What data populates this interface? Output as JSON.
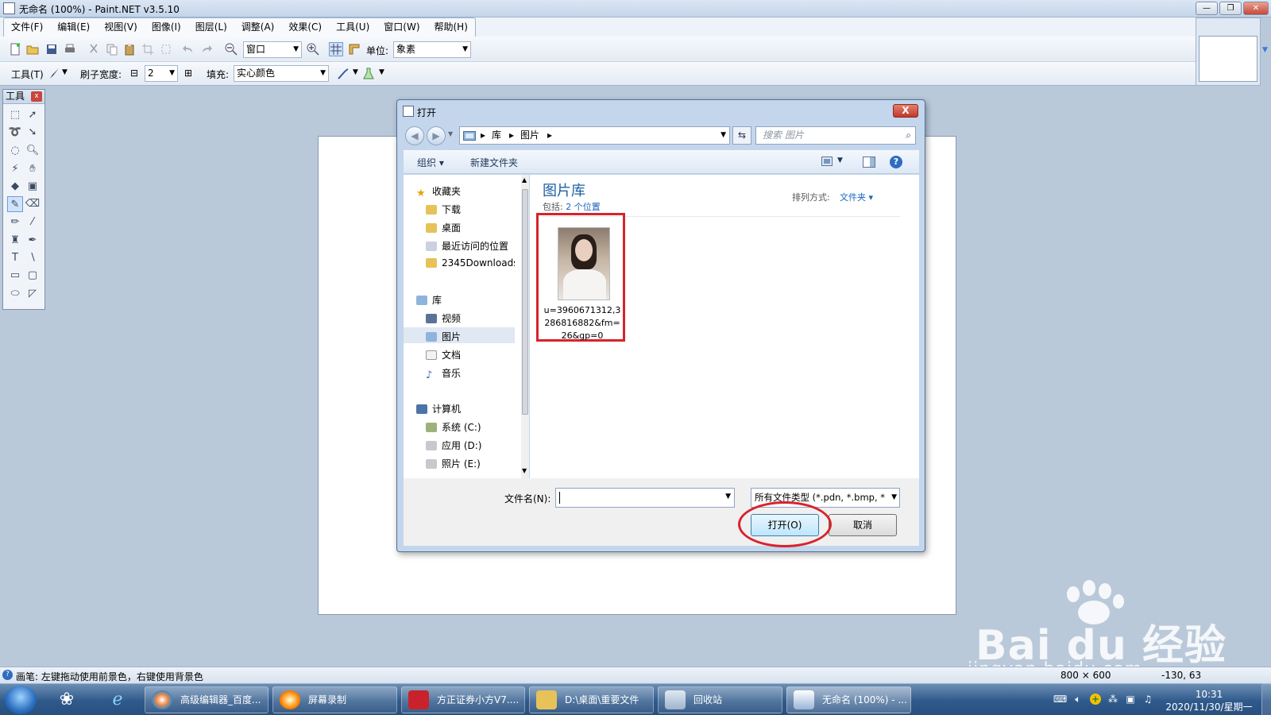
{
  "app": {
    "title": "无命名 (100%) - Paint.NET v3.5.10"
  },
  "menu": [
    "文件(F)",
    "编辑(E)",
    "视图(V)",
    "图像(I)",
    "图层(L)",
    "调整(A)",
    "效果(C)",
    "工具(U)",
    "窗口(W)",
    "帮助(H)"
  ],
  "toolbar1": {
    "zoom_value": "窗口",
    "unit_label": "单位:",
    "unit_value": "象素"
  },
  "toolbar2": {
    "tool_label": "工具(T)",
    "brush_width_label": "刷子宽度:",
    "brush_width_value": "2",
    "fill_label": "填充:",
    "fill_value": "实心颜色"
  },
  "tools_panel": {
    "title": "工具",
    "close": "x"
  },
  "dialog": {
    "title": "打开",
    "close": "X",
    "address": {
      "items": [
        "库",
        "图片"
      ]
    },
    "search_placeholder": "搜索 图片",
    "commands": {
      "organize": "组织 ▾",
      "new_folder": "新建文件夹"
    },
    "nav": {
      "favorites": "收藏夹",
      "favorites_items": [
        "下载",
        "桌面",
        "最近访问的位置",
        "2345Downloads"
      ],
      "libraries": "库",
      "libraries_items": [
        "视频",
        "图片",
        "文档",
        "音乐"
      ],
      "computer": "计算机",
      "computer_items": [
        "系统 (C:)",
        "应用 (D:)",
        "照片 (E:)"
      ]
    },
    "library": {
      "title": "图片库",
      "includes_label": "包括:",
      "includes_link": "2 个位置",
      "sort_label": "排列方式:",
      "sort_value": "文件夹 ▾"
    },
    "file": {
      "name": "u=3960671312,3286816882&fm=26&gp=0"
    },
    "filename_label": "文件名(N):",
    "filename_value": "",
    "filetype_value": "所有文件类型 (*.pdn, *.bmp, *",
    "open_button": "打开(O)",
    "cancel_button": "取消"
  },
  "statusbar": {
    "hint": "画笔: 左键拖动使用前景色，右键使用背景色",
    "size": "800 × 600",
    "position": "-130, 63"
  },
  "taskbar": {
    "tasks": [
      "高级编辑器_百度...",
      "屏幕录制",
      "方正证券小方V7....",
      "D:\\桌面\\重要文件",
      "回收站",
      "无命名 (100%) - ..."
    ],
    "clock_time": "10:31",
    "clock_date": "2020/11/30/星期一"
  },
  "watermark": {
    "brand": "Bai du 经验",
    "url": "jingyan.baidu.com"
  },
  "colors": {
    "red_highlight": "#d7232c",
    "link_blue": "#1565c0",
    "taskbar": "#2f5a8c"
  }
}
